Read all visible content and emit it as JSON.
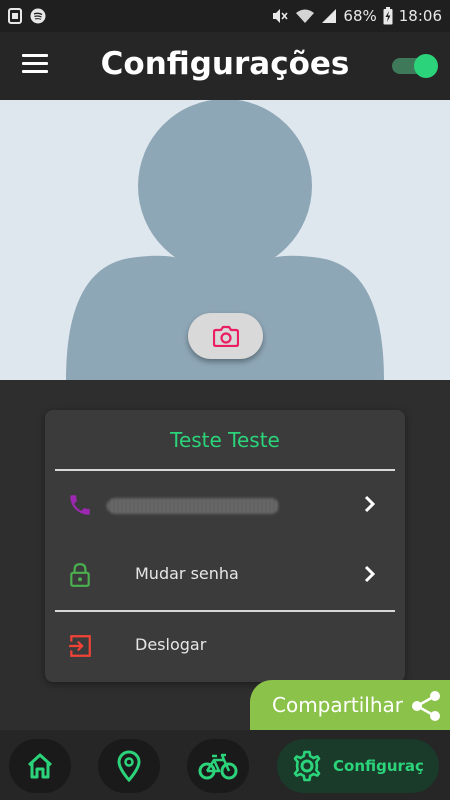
{
  "status_bar": {
    "battery": "68%",
    "time": "18:06"
  },
  "header": {
    "title": "Configurações"
  },
  "profile": {
    "user_name": "Teste Teste"
  },
  "settings": {
    "items": [
      {
        "icon": "phone-icon",
        "label": ""
      },
      {
        "icon": "lock-icon",
        "label": "Mudar senha"
      },
      {
        "icon": "logout-icon",
        "label": "Deslogar"
      }
    ]
  },
  "share": {
    "label": "Compartilhar"
  },
  "bottom_nav": {
    "items": [
      {
        "icon": "home-icon"
      },
      {
        "icon": "location-pin-icon"
      },
      {
        "icon": "bicycle-icon"
      },
      {
        "icon": "gear-icon",
        "label": "Configuraç"
      }
    ]
  },
  "colors": {
    "accent": "#2bd47a",
    "share_bg": "#8bc34a",
    "phone_icon": "#9c27b0",
    "lock_icon": "#4caf50",
    "logout_icon": "#f44336",
    "camera_icon": "#e91e63"
  }
}
